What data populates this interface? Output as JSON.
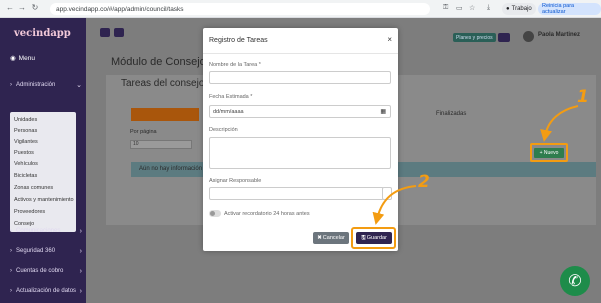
{
  "browser": {
    "url": "app.vecindapp.co/#/app/admin/council/tasks",
    "profile": "Trabajo",
    "update_label": "Reinicia para actualizar"
  },
  "sidebar": {
    "logo": "vecindapp",
    "menu_label": "Menu",
    "administracion": "Administración",
    "submenu": [
      "Unidades",
      "Personas",
      "Vigilantes",
      "Puestos",
      "Vehículos",
      "Bicicletas",
      "Zonas comunes",
      "Activos y mantenimiento",
      "Proveedores",
      "Consejo"
    ],
    "sections": [
      "Comunicaciones",
      "Seguridad 360",
      "Cuentas de cobro",
      "Actualización de datos"
    ]
  },
  "main": {
    "title": "Módulo de Consejo",
    "card_title": "Tareas del consejo",
    "tab_finalizadas": "Finalizadas",
    "por_pagina_label": "Por página",
    "per_page_value": "10",
    "info_text": "Aún no hay información",
    "user_name": "Paola Martinez",
    "plans_label": "Planes y precios",
    "new_button": "+ Nuevo"
  },
  "modal": {
    "title": "Registro de Tareas",
    "close": "×",
    "name_label": "Nombre de la Tarea *",
    "date_label": "Fecha Estimada *",
    "date_placeholder": "dd/mm/aaaa",
    "description_label": "Descripción",
    "responsible_label": "Asignar Responsable",
    "toggle_label": "Activar recordatorio 24 horas antes",
    "cancel_label": "Cancelar",
    "save_label": "Guardar"
  },
  "annotations": {
    "step1": "1",
    "step2": "2"
  },
  "colors": {
    "sidebar_bg": "#2f2450",
    "accent_orange": "#f39c12",
    "save_button": "#2f2450",
    "cancel_button": "#6c757d",
    "whatsapp": "#1e8c4a"
  },
  "icons": [
    "back-arrow-icon",
    "forward-arrow-icon",
    "reload-icon",
    "calendar-icon",
    "close-icon",
    "whatsapp-phone-icon",
    "save-icon",
    "cancel-icon"
  ]
}
